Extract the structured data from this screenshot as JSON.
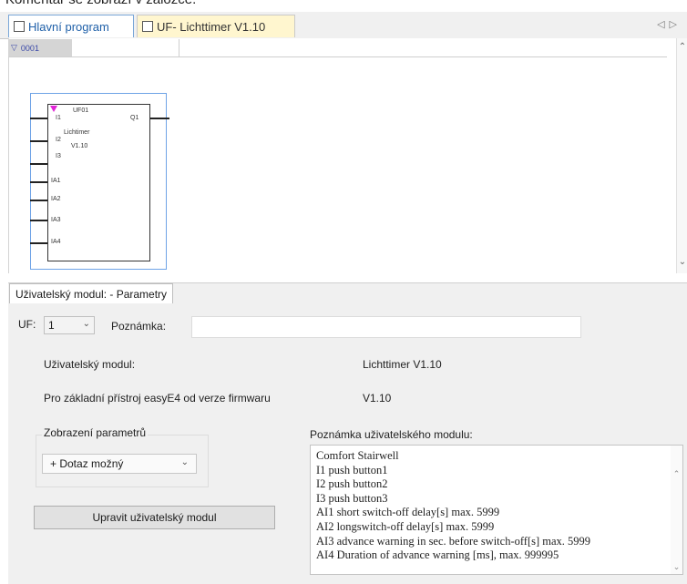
{
  "caption": "Komentář se zobrazí v záložce.",
  "tabs": [
    {
      "label": "Hlavní program"
    },
    {
      "label": "UF- Lichttimer V1.10"
    }
  ],
  "tab_scroll": {
    "left": "◁",
    "right": "▷"
  },
  "editor": {
    "row_label": "0001",
    "block": {
      "name": "UF01",
      "desc_line1": "Lichtimer",
      "desc_line2": "V1.10",
      "inputs": [
        "I1",
        "I2",
        "I3",
        "IA1",
        "IA2",
        "IA3",
        "IA4"
      ],
      "output": "Q1"
    }
  },
  "panel": {
    "tab_label": "Uživatelský modul: - Parametry",
    "uf_label": "UF:",
    "uf_value": "1",
    "note_label": "Poznámka:",
    "note_value": "",
    "module_label": "Uživatelský modul:",
    "module_value": "Lichttimer V1.10",
    "firmware_label": "Pro základní přístroj easyE4 od verze firmwaru",
    "firmware_value": "V1.10",
    "param_group_label": "Zobrazení parametrů",
    "param_value": "+ Dotaz možný",
    "edit_button": "Upravit uživatelský modul",
    "comment_label": "Poznámka uživatelského modulu:",
    "comment_lines": [
      "Comfort Stairwell",
      "I1 push button1",
      "I2 push button2",
      "I3 push button3",
      "AI1 short switch-off delay[s] max. 5999",
      "AI2 longswitch-off delay[s] max. 5999",
      "AI3 advance warning in sec. before switch-off[s] max. 5999",
      "AI4 Duration of advance warning [ms], max. 999995"
    ]
  },
  "colors": {
    "block_marker": "#e024d6",
    "selection": "#6ea3e6",
    "uf_tab_bg": "#fff6cf"
  }
}
